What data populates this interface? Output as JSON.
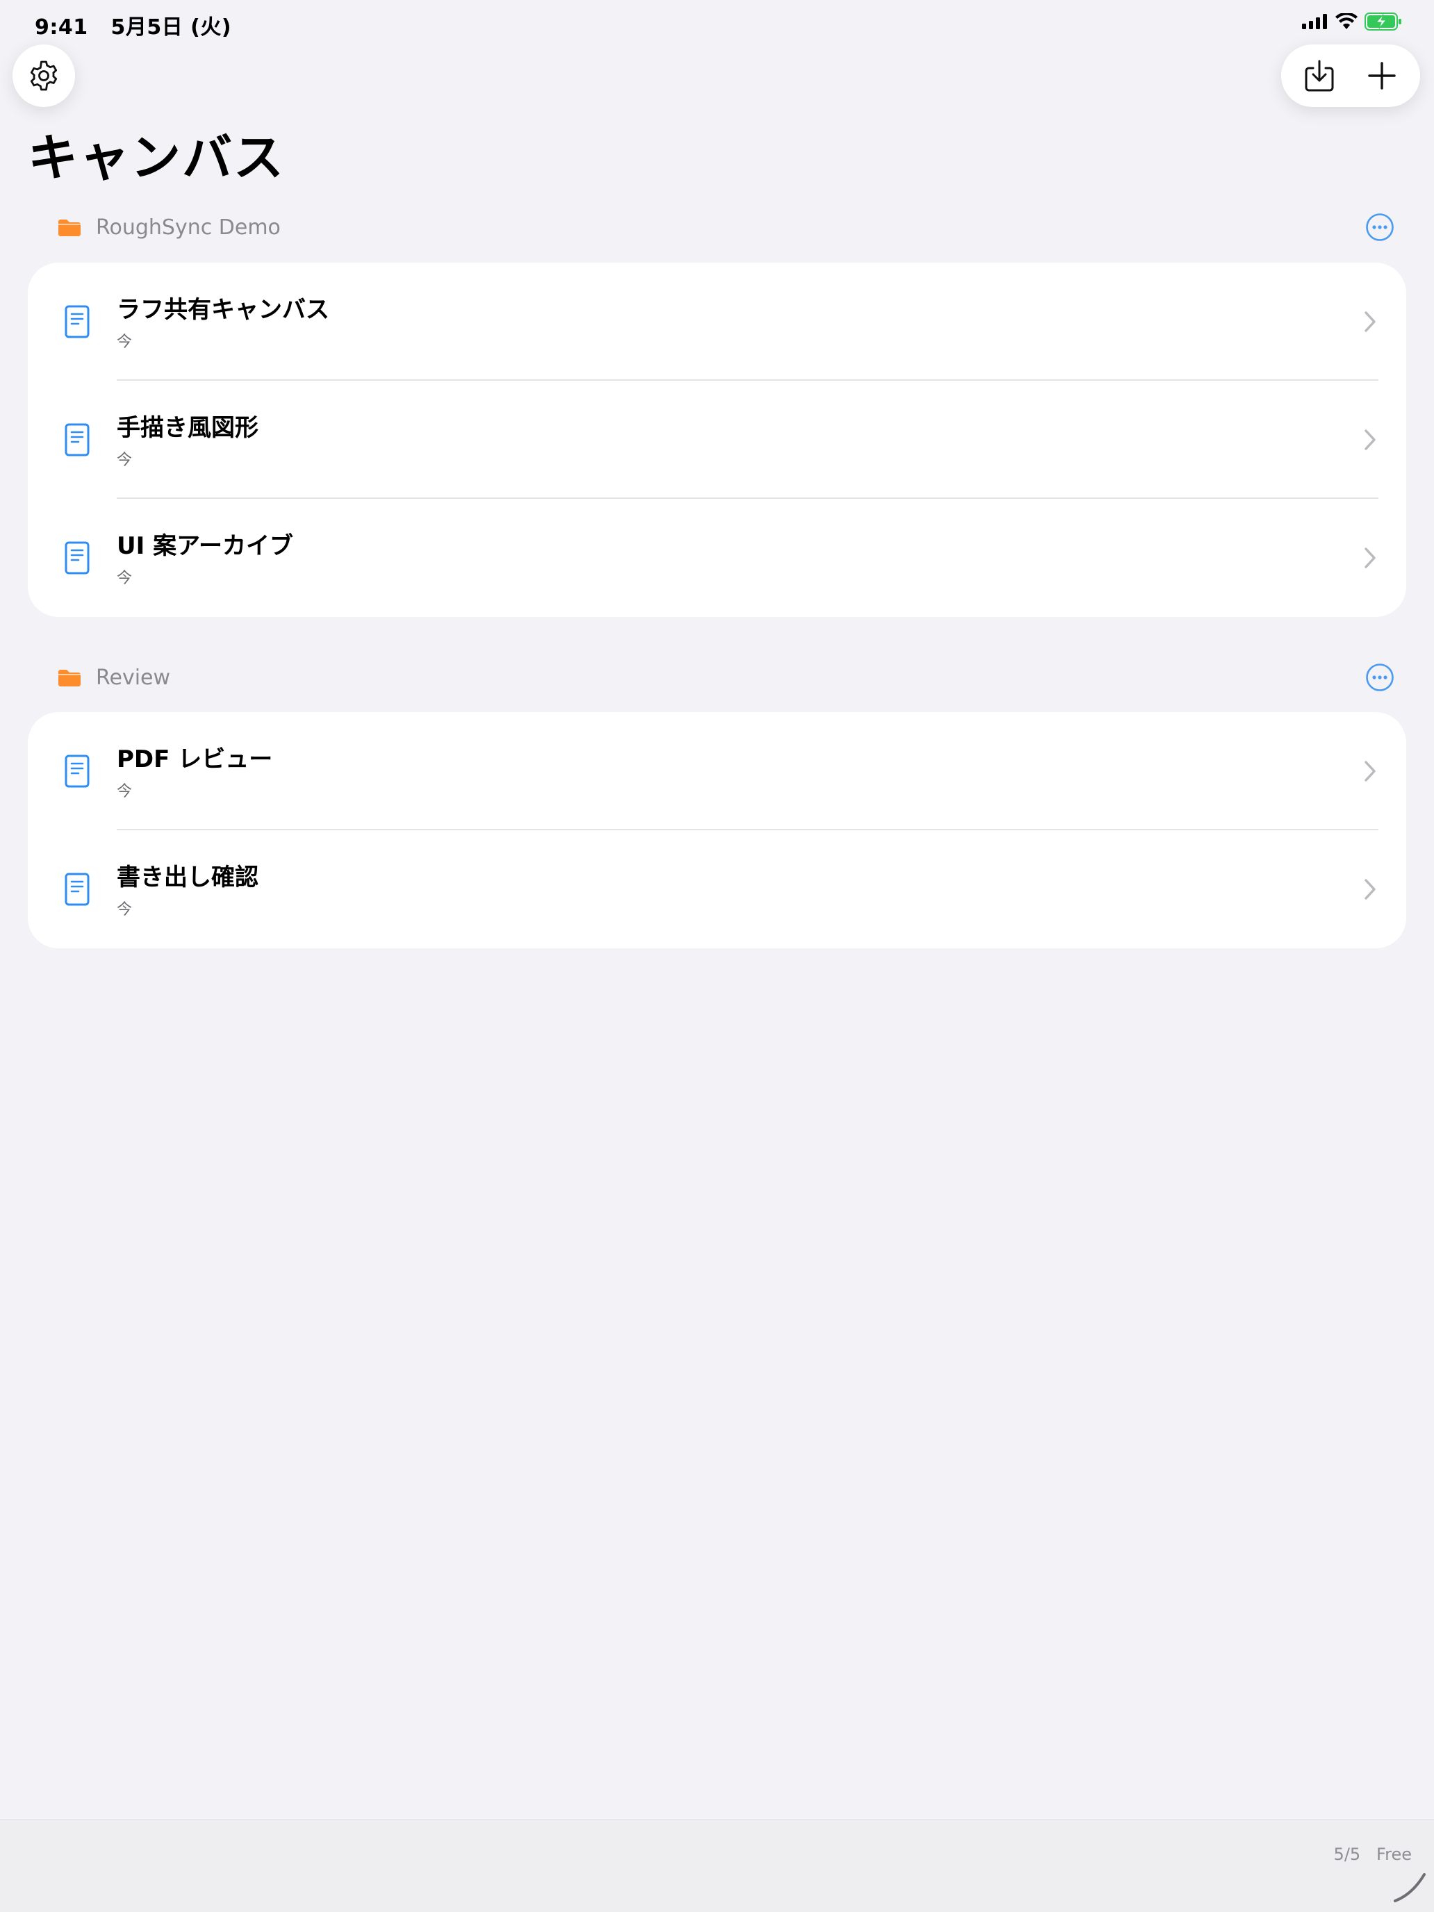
{
  "status_bar": {
    "time": "9:41",
    "date": "5月5日 (火)",
    "icons": [
      "cellular-signal-icon",
      "wifi-icon",
      "battery-charging-icon"
    ],
    "battery_color": "#34c759"
  },
  "toolbar": {
    "settings_icon": "gear-icon",
    "import_icon": "tray-download-icon",
    "add_icon": "plus-icon"
  },
  "page_title": "キャンバス",
  "accent_color": "#2f8cf0",
  "folder_color": "#fd8d2c",
  "sections": [
    {
      "folder": "RoughSync Demo",
      "items": [
        {
          "title": "ラフ共有キャンバス",
          "subtitle": "今"
        },
        {
          "title": "手描き風図形",
          "subtitle": "今"
        },
        {
          "title": "UI 案アーカイブ",
          "subtitle": "今"
        }
      ]
    },
    {
      "folder": "Review",
      "items": [
        {
          "title": "PDF レビュー",
          "subtitle": "今"
        },
        {
          "title": "書き出し確認",
          "subtitle": "今"
        }
      ]
    }
  ],
  "footer": {
    "plan_label": "5/5   Free"
  }
}
